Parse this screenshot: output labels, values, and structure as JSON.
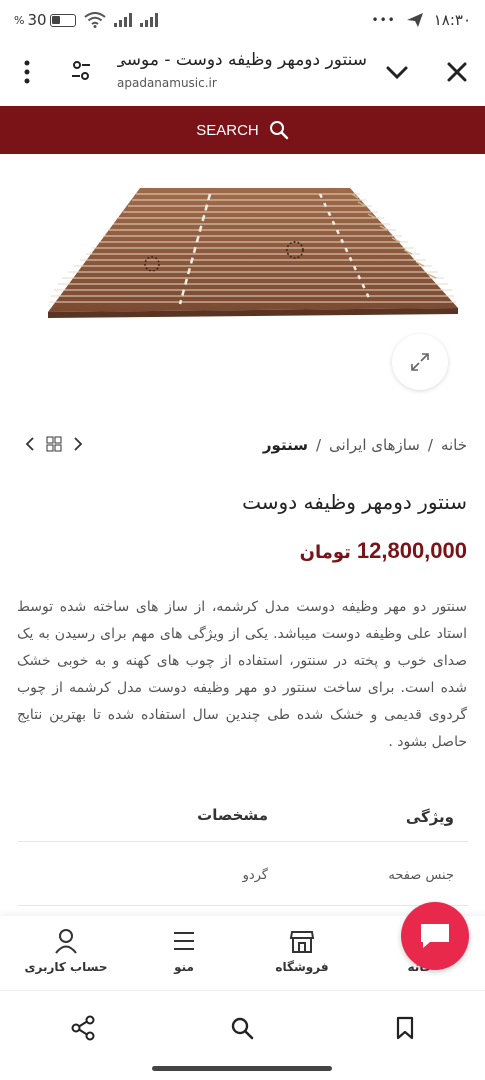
{
  "status": {
    "battery_text": "30",
    "time": "۱۸:۳۰",
    "more_dots": "•••"
  },
  "browser": {
    "title": "سنتور دومهر وظیفه دوست - موسی..",
    "url": "apadanamusic.ir"
  },
  "search": {
    "label": "SEARCH"
  },
  "breadcrumb": {
    "home": "خانه",
    "sep": "/",
    "category": "سازهای ایرانی",
    "current": "سنتور"
  },
  "product": {
    "title": "سنتور دومهر وظیفه دوست",
    "price": "12,800,000",
    "currency": "تومان",
    "description": "سنتور دو مهر وظیفه دوست مدل کرشمه، از ساز های ساخته شده توسط استاد علی وظیفه دوست میباشد. یکی از ویژگی های مهم برای رسیدن به یک صدای خوب و پخته در سنتور، استفاده از چوب های کهنه و به خوبی خشک شده است. برای ساخت سنتور دو مهر وظیفه دوست مدل کرشمه از چوب گردوی قدیمی و خشک شده طی چندین سال استفاده شده تا بهترین نتایج حاصل بشود ."
  },
  "specs": {
    "header_feature": "ویژگی",
    "header_spec": "مشخصات",
    "rows": [
      {
        "key": "جنس صفحه",
        "value": "گردو"
      }
    ]
  },
  "tabbar": {
    "home": "خانه",
    "shop": "فروشگاه",
    "menu": "منو",
    "account": "حساب کاربری"
  },
  "colors": {
    "brand": "#7a1317",
    "chat": "#e8294b"
  }
}
